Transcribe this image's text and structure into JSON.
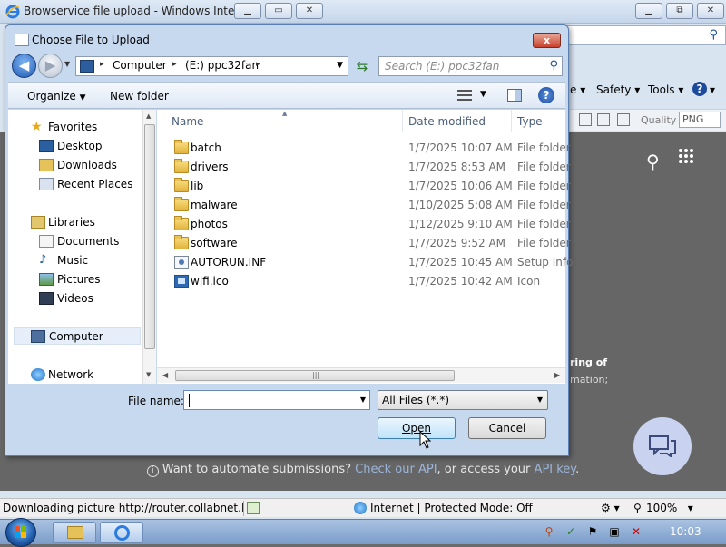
{
  "ie": {
    "title": "Browservice file upload - Windows Intern...",
    "commands": {
      "safety": "Safety",
      "tools": "Tools"
    },
    "quality_label": "Quality",
    "quality_value": "PNG",
    "page_text_1": "ring of",
    "page_text_2": "mation;",
    "automate": {
      "prefix": "Want to automate submissions?",
      "link1": "Check our API",
      "middle": ", or access your",
      "link2": "API key",
      "suffix": "."
    },
    "status": {
      "text": "Downloading picture http://router.collabnet.l",
      "zone": "Internet | Protected Mode: Off",
      "zoom": "100%"
    }
  },
  "taskbar": {
    "clock": "10:03"
  },
  "dialog": {
    "title": "Choose File to Upload",
    "close_label": "x",
    "breadcrumb": [
      "Computer",
      "(E:) ppc32fan"
    ],
    "search_placeholder": "Search (E:) ppc32fan",
    "toolbar": {
      "organize": "Organize",
      "new_folder": "New folder"
    },
    "nav": {
      "favorites": "Favorites",
      "desktop": "Desktop",
      "downloads": "Downloads",
      "recent": "Recent Places",
      "libraries": "Libraries",
      "documents": "Documents",
      "music": "Music",
      "pictures": "Pictures",
      "videos": "Videos",
      "computer": "Computer",
      "network": "Network"
    },
    "columns": {
      "name": "Name",
      "date": "Date modified",
      "type": "Type"
    },
    "files": [
      {
        "name": "batch",
        "date": "1/7/2025 10:07 AM",
        "type": "File folder",
        "icon": "folder-icon"
      },
      {
        "name": "drivers",
        "date": "1/7/2025 8:53 AM",
        "type": "File folder",
        "icon": "folder-icon"
      },
      {
        "name": "lib",
        "date": "1/7/2025 10:06 AM",
        "type": "File folder",
        "icon": "folder-icon"
      },
      {
        "name": "malware",
        "date": "1/10/2025 5:08 AM",
        "type": "File folder",
        "icon": "folder-icon"
      },
      {
        "name": "photos",
        "date": "1/12/2025 9:10 AM",
        "type": "File folder",
        "icon": "folder-icon"
      },
      {
        "name": "software",
        "date": "1/7/2025 9:52 AM",
        "type": "File folder",
        "icon": "folder-icon"
      },
      {
        "name": "AUTORUN.INF",
        "date": "1/7/2025 10:45 AM",
        "type": "Setup Info",
        "icon": "setup-info-icon"
      },
      {
        "name": "wifi.ico",
        "date": "1/7/2025 10:42 AM",
        "type": "Icon",
        "icon": "image-icon"
      }
    ],
    "file_name_label": "File name:",
    "file_name_value": "",
    "filter": "All Files (*.*)",
    "open_label": "Open",
    "cancel_label": "Cancel"
  }
}
